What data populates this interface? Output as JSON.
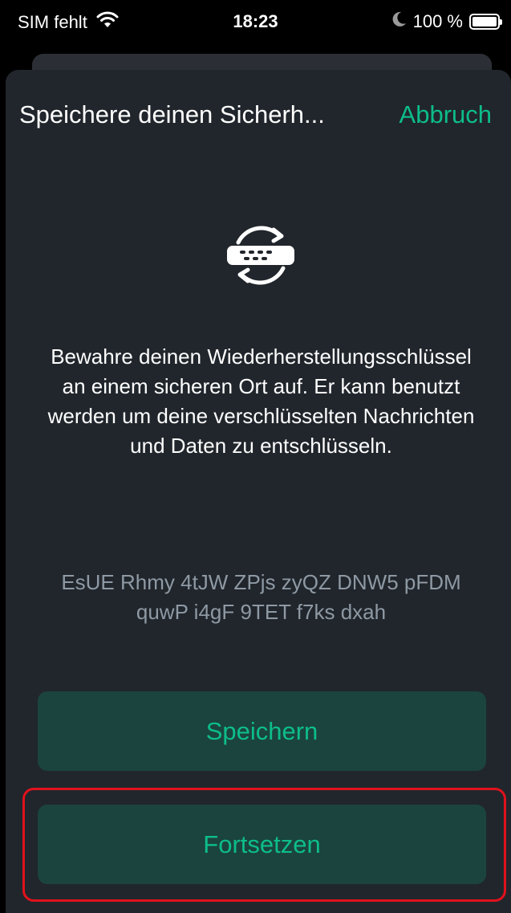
{
  "status_bar": {
    "carrier": "SIM fehlt",
    "time": "18:23",
    "battery": "100 %",
    "icons": [
      "wifi-icon",
      "moon-icon",
      "battery-icon"
    ]
  },
  "sheet": {
    "title": "Speichere deinen Sicherh...",
    "cancel_label": "Abbruch",
    "icon": "key-backup-icon",
    "description": "Bewahre deinen Wiederherstellungsschlüssel an einem sicheren Ort auf. Er kann benutzt werden um deine verschlüsselten Nachrichten und Daten zu entschlüsseln.",
    "recovery_key": "EsUE Rhmy 4tJW ZPjs zyQZ DNW5 pFDM quwP i4gF 9TET f7ks dxah",
    "save_label": "Speichern",
    "continue_label": "Fortsetzen"
  },
  "colors": {
    "accent": "#0dbd8b",
    "sheet_background": "#21262c",
    "button_background": "#1b443e",
    "highlight": "#e0121c"
  }
}
